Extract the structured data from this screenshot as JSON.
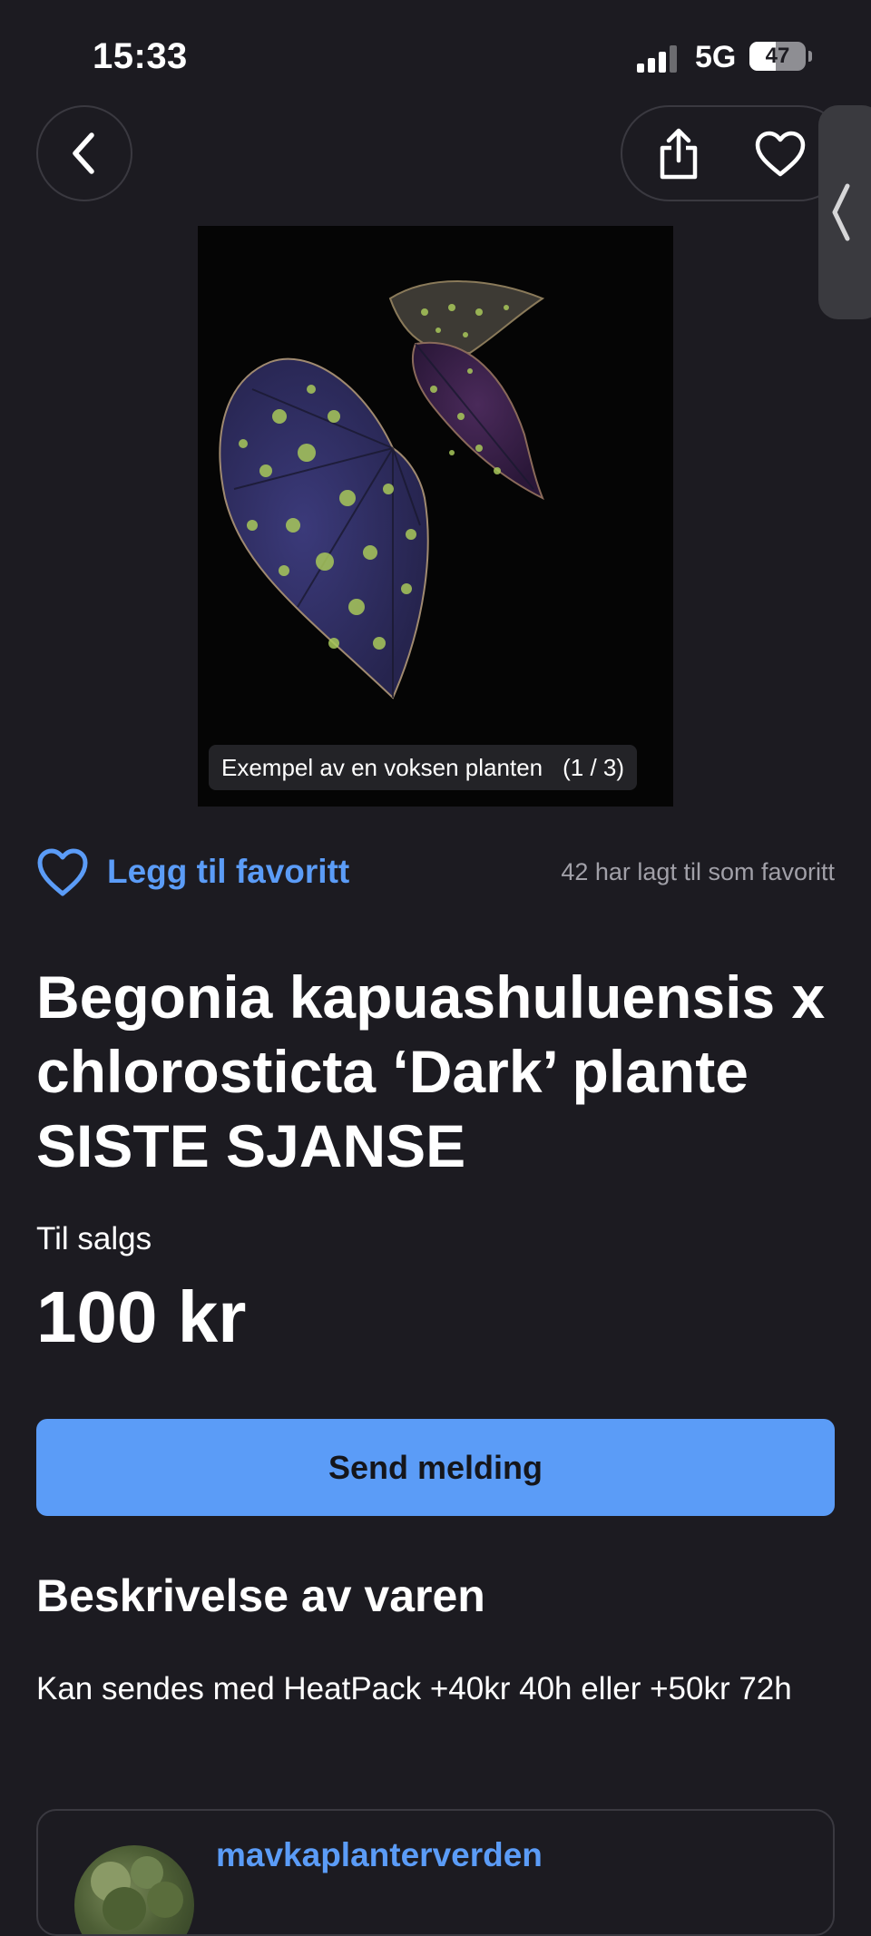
{
  "status_bar": {
    "time": "15:33",
    "network": "5G",
    "battery": "47",
    "battery_level_percent": 47
  },
  "nav": {
    "back_icon": "chevron-left-icon",
    "share_icon": "share-icon",
    "favorite_icon": "heart-icon",
    "side_handle_icon": "chevron-left-icon"
  },
  "image": {
    "caption": "Exempel av en voksen planten",
    "counter": "(1 / 3)"
  },
  "favorite": {
    "label": "Legg til favoritt",
    "count_text": "42 har lagt til som favoritt",
    "icon": "heart-icon"
  },
  "listing": {
    "title": "Begonia kapuashuluensis x chlorosticta ‘Dark’ plante SISTE SJANSE",
    "status": "Til salgs",
    "price": "100 kr"
  },
  "actions": {
    "send_message": "Send melding"
  },
  "description": {
    "heading": "Beskrivelse av varen",
    "text": "Kan sendes med HeatPack +40kr 40h eller +50kr 72h"
  },
  "seller": {
    "name": "mavkaplanterverden"
  },
  "colors": {
    "background": "#1c1b21",
    "accent": "#5b9cf7",
    "muted_text": "#a1a0a8",
    "border": "#3a3940"
  }
}
